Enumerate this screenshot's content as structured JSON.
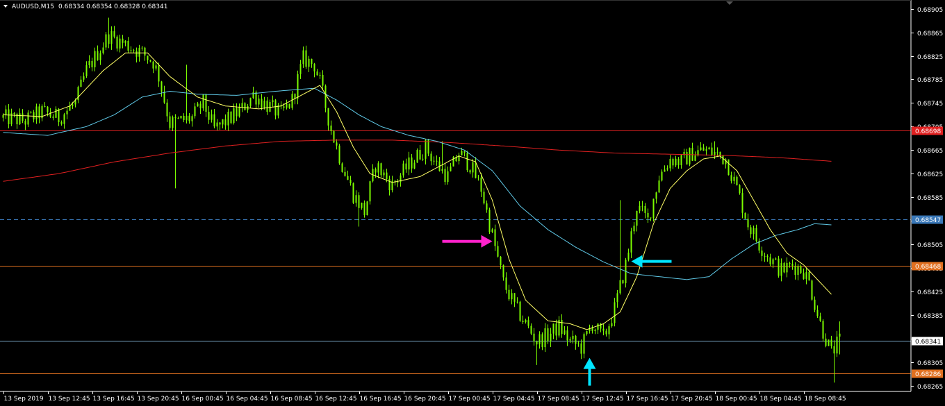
{
  "header": {
    "symbol_label": "AUDUSD,M15",
    "ohlc_text": "0.68334 0.68354 0.68328 0.68341",
    "collapse_icon": "triangle-down-icon"
  },
  "colors": {
    "background": "#000000",
    "candle": "#7CFC00",
    "ma_fast": "#ffff66",
    "ma_mid": "#5fc8e6",
    "ma_slow": "#e02020",
    "level_red": "#e02020",
    "level_orange": "#e07020",
    "level_blue_dashed": "#3a78b8",
    "level_current": "#7aa8c8",
    "arrow_magenta": "#ff22cc",
    "arrow_cyan": "#00e5ff"
  },
  "chart_data": {
    "type": "candlestick",
    "ylim": [
      0.68255,
      0.6892
    ],
    "y_ticks": [
      {
        "v": 0.68905,
        "label": "0.68905"
      },
      {
        "v": 0.68865,
        "label": "0.68865"
      },
      {
        "v": 0.68825,
        "label": "0.68825"
      },
      {
        "v": 0.68785,
        "label": "0.68785"
      },
      {
        "v": 0.68745,
        "label": "0.68745"
      },
      {
        "v": 0.68705,
        "label": "0.68705"
      },
      {
        "v": 0.68665,
        "label": "0.68665"
      },
      {
        "v": 0.68625,
        "label": "0.68625"
      },
      {
        "v": 0.68585,
        "label": "0.68585"
      },
      {
        "v": 0.68545,
        "label": "0.68545"
      },
      {
        "v": 0.68505,
        "label": "0.68505"
      },
      {
        "v": 0.68465,
        "label": "0.68465"
      },
      {
        "v": 0.68425,
        "label": "0.68425"
      },
      {
        "v": 0.68385,
        "label": "0.68385"
      },
      {
        "v": 0.68345,
        "label": "0.68345"
      },
      {
        "v": 0.68305,
        "label": "0.68305"
      },
      {
        "v": 0.68265,
        "label": "0.68265"
      }
    ],
    "x_ticks": [
      {
        "i": 0,
        "label": "13 Sep 2019"
      },
      {
        "i": 16,
        "label": "13 Sep 12:45"
      },
      {
        "i": 32,
        "label": "13 Sep 16:45"
      },
      {
        "i": 48,
        "label": "13 Sep 20:45"
      },
      {
        "i": 64,
        "label": "16 Sep 00:45"
      },
      {
        "i": 80,
        "label": "16 Sep 04:45"
      },
      {
        "i": 96,
        "label": "16 Sep 08:45"
      },
      {
        "i": 112,
        "label": "16 Sep 12:45"
      },
      {
        "i": 128,
        "label": "16 Sep 16:45"
      },
      {
        "i": 144,
        "label": "16 Sep 20:45"
      },
      {
        "i": 160,
        "label": "17 Sep 00:45"
      },
      {
        "i": 176,
        "label": "17 Sep 04:45"
      },
      {
        "i": 192,
        "label": "17 Sep 08:45"
      },
      {
        "i": 208,
        "label": "17 Sep 12:45"
      },
      {
        "i": 224,
        "label": "17 Sep 16:45"
      },
      {
        "i": 240,
        "label": "17 Sep 20:45"
      },
      {
        "i": 256,
        "label": "18 Sep 00:45"
      },
      {
        "i": 272,
        "label": "18 Sep 04:45"
      },
      {
        "i": 288,
        "label": "18 Sep 08:45"
      }
    ],
    "bar_count": 302,
    "price_path": [
      [
        0,
        0.6872
      ],
      [
        8,
        0.68715
      ],
      [
        14,
        0.6873
      ],
      [
        20,
        0.6872
      ],
      [
        26,
        0.68745
      ],
      [
        30,
        0.688
      ],
      [
        38,
        0.6886
      ],
      [
        44,
        0.68845
      ],
      [
        50,
        0.6883
      ],
      [
        54,
        0.68815
      ],
      [
        56,
        0.6879
      ],
      [
        60,
        0.6871
      ],
      [
        64,
        0.68715
      ],
      [
        68,
        0.6872
      ],
      [
        72,
        0.68745
      ],
      [
        76,
        0.687
      ],
      [
        82,
        0.6872
      ],
      [
        86,
        0.68735
      ],
      [
        90,
        0.6876
      ],
      [
        94,
        0.68745
      ],
      [
        100,
        0.68725
      ],
      [
        104,
        0.6875
      ],
      [
        108,
        0.6882
      ],
      [
        112,
        0.6881
      ],
      [
        114,
        0.6878
      ],
      [
        118,
        0.687
      ],
      [
        122,
        0.6864
      ],
      [
        126,
        0.6859
      ],
      [
        130,
        0.6856
      ],
      [
        134,
        0.6864
      ],
      [
        140,
        0.68605
      ],
      [
        146,
        0.6864
      ],
      [
        152,
        0.6867
      ],
      [
        156,
        0.6864
      ],
      [
        160,
        0.6862
      ],
      [
        164,
        0.6866
      ],
      [
        168,
        0.6864
      ],
      [
        172,
        0.686
      ],
      [
        176,
        0.6852
      ],
      [
        180,
        0.6844
      ],
      [
        184,
        0.684
      ],
      [
        188,
        0.6837
      ],
      [
        192,
        0.6834
      ],
      [
        196,
        0.6835
      ],
      [
        200,
        0.68365
      ],
      [
        204,
        0.6834
      ],
      [
        208,
        0.6833
      ],
      [
        212,
        0.6837
      ],
      [
        216,
        0.68345
      ],
      [
        220,
        0.68395
      ],
      [
        224,
        0.6847
      ],
      [
        228,
        0.6857
      ],
      [
        232,
        0.68545
      ],
      [
        236,
        0.6862
      ],
      [
        240,
        0.6865
      ],
      [
        244,
        0.68645
      ],
      [
        248,
        0.6866
      ],
      [
        252,
        0.68665
      ],
      [
        256,
        0.6866
      ],
      [
        260,
        0.6865
      ],
      [
        264,
        0.686
      ],
      [
        268,
        0.6854
      ],
      [
        272,
        0.68505
      ],
      [
        276,
        0.6848
      ],
      [
        280,
        0.6846
      ],
      [
        284,
        0.6847
      ],
      [
        288,
        0.6846
      ],
      [
        290,
        0.6844
      ],
      [
        294,
        0.6837
      ],
      [
        298,
        0.6832
      ],
      [
        301,
        0.68341
      ]
    ],
    "spikes": [
      {
        "i": 38,
        "high": 0.6889
      },
      {
        "i": 62,
        "low": 0.686
      },
      {
        "i": 66,
        "high": 0.6881
      },
      {
        "i": 128,
        "low": 0.68535
      },
      {
        "i": 158,
        "high": 0.6868
      },
      {
        "i": 192,
        "low": 0.683
      },
      {
        "i": 208,
        "low": 0.6831
      },
      {
        "i": 222,
        "high": 0.6858
      },
      {
        "i": 256,
        "high": 0.6868
      },
      {
        "i": 299,
        "low": 0.6827
      }
    ],
    "ma_fast": [
      [
        0,
        0.68725
      ],
      [
        14,
        0.68722
      ],
      [
        24,
        0.6874
      ],
      [
        36,
        0.688
      ],
      [
        44,
        0.6883
      ],
      [
        52,
        0.6883
      ],
      [
        60,
        0.6879
      ],
      [
        70,
        0.68755
      ],
      [
        80,
        0.6874
      ],
      [
        92,
        0.68735
      ],
      [
        100,
        0.6874
      ],
      [
        108,
        0.6876
      ],
      [
        114,
        0.68775
      ],
      [
        120,
        0.6873
      ],
      [
        126,
        0.6867
      ],
      [
        132,
        0.68625
      ],
      [
        140,
        0.6861
      ],
      [
        150,
        0.6862
      ],
      [
        158,
        0.6864
      ],
      [
        164,
        0.68655
      ],
      [
        170,
        0.68645
      ],
      [
        176,
        0.6858
      ],
      [
        182,
        0.6848
      ],
      [
        188,
        0.6841
      ],
      [
        196,
        0.68375
      ],
      [
        204,
        0.6837
      ],
      [
        210,
        0.6836
      ],
      [
        216,
        0.6837
      ],
      [
        222,
        0.6839
      ],
      [
        228,
        0.6845
      ],
      [
        234,
        0.6854
      ],
      [
        240,
        0.686
      ],
      [
        246,
        0.6863
      ],
      [
        252,
        0.6865
      ],
      [
        258,
        0.68655
      ],
      [
        264,
        0.6863
      ],
      [
        270,
        0.6858
      ],
      [
        276,
        0.6853
      ],
      [
        282,
        0.6849
      ],
      [
        288,
        0.6847
      ],
      [
        294,
        0.6844
      ],
      [
        298,
        0.6842
      ]
    ],
    "ma_mid": [
      [
        0,
        0.68695
      ],
      [
        16,
        0.6869
      ],
      [
        30,
        0.68705
      ],
      [
        40,
        0.68725
      ],
      [
        50,
        0.68755
      ],
      [
        60,
        0.68765
      ],
      [
        70,
        0.6876
      ],
      [
        84,
        0.68758
      ],
      [
        98,
        0.68765
      ],
      [
        112,
        0.6877
      ],
      [
        120,
        0.6875
      ],
      [
        128,
        0.68725
      ],
      [
        136,
        0.68705
      ],
      [
        146,
        0.6869
      ],
      [
        156,
        0.6868
      ],
      [
        166,
        0.68665
      ],
      [
        176,
        0.6863
      ],
      [
        186,
        0.6857
      ],
      [
        196,
        0.6853
      ],
      [
        206,
        0.685
      ],
      [
        216,
        0.68475
      ],
      [
        226,
        0.68455
      ],
      [
        236,
        0.6845
      ],
      [
        246,
        0.68445
      ],
      [
        254,
        0.6845
      ],
      [
        262,
        0.6848
      ],
      [
        270,
        0.68505
      ],
      [
        278,
        0.6852
      ],
      [
        286,
        0.6853
      ],
      [
        292,
        0.6854
      ],
      [
        298,
        0.68538
      ]
    ],
    "ma_slow": [
      [
        0,
        0.68612
      ],
      [
        20,
        0.68625
      ],
      [
        40,
        0.68645
      ],
      [
        60,
        0.6866
      ],
      [
        80,
        0.68672
      ],
      [
        100,
        0.6868
      ],
      [
        120,
        0.68682
      ],
      [
        140,
        0.68682
      ],
      [
        160,
        0.68678
      ],
      [
        180,
        0.68672
      ],
      [
        200,
        0.68665
      ],
      [
        220,
        0.6866
      ],
      [
        240,
        0.68658
      ],
      [
        260,
        0.68656
      ],
      [
        280,
        0.68652
      ],
      [
        292,
        0.68648
      ],
      [
        298,
        0.68646
      ]
    ],
    "levels": [
      {
        "price": 0.68698,
        "label": "0.68698",
        "style": "solid",
        "color_key": "level_red",
        "tag_text": "#ffffff"
      },
      {
        "price": 0.68547,
        "label": "0.68547",
        "style": "dashed",
        "color_key": "level_blue_dashed",
        "tag_text": "#ffffff"
      },
      {
        "price": 0.68468,
        "label": "0.68468",
        "style": "solid",
        "color_key": "level_orange",
        "tag_text": "#ffffff"
      },
      {
        "price": 0.68341,
        "label": "0.68341",
        "style": "solid",
        "color_key": "level_current",
        "tag_text": "#000000",
        "tag_bg": "#ffffff"
      },
      {
        "price": 0.68286,
        "label": "0.68286",
        "style": "solid",
        "color_key": "level_orange",
        "tag_text": "#ffffff"
      }
    ],
    "annotations": [
      {
        "name": "magenta-arrow-right",
        "color_key": "arrow_magenta",
        "direction": "right",
        "i": 176,
        "price": 0.6851
      },
      {
        "name": "cyan-arrow-left",
        "color_key": "arrow_cyan",
        "direction": "left",
        "i": 226,
        "price": 0.68476
      },
      {
        "name": "cyan-arrow-up",
        "color_key": "arrow_cyan",
        "direction": "up",
        "i": 211,
        "price": 0.68312
      }
    ]
  }
}
